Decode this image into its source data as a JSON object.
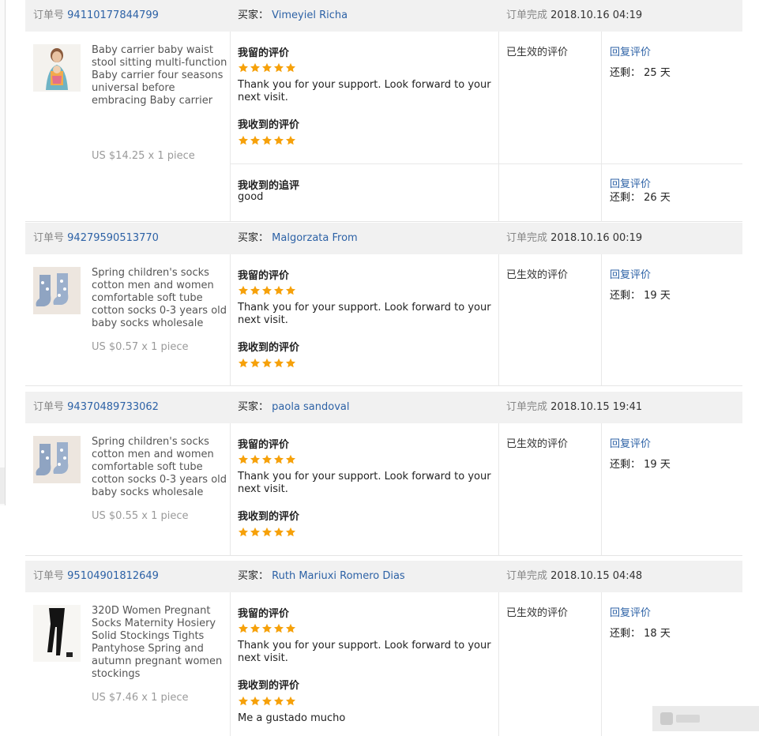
{
  "labels": {
    "order_no": "订单号",
    "buyer": "买家：",
    "order_done": "订单完成",
    "my_review": "我留的评价",
    "received_review": "我收到的评价",
    "received_followup": "我收到的追评",
    "status": "已生效的评价",
    "reply": "回复评价",
    "remaining": "还剩：",
    "days_unit": "天"
  },
  "colors": {
    "link": "#2d62a6",
    "star": "#f6a10a",
    "header_bg": "#f1f1f1"
  },
  "orders": [
    {
      "order_id": "94110177844799",
      "buyer": "Vimeyiel Richa",
      "completed": "2018.10.16 04:19",
      "product": {
        "image": "baby-carrier-photo",
        "title": "Baby carrier baby waist stool sitting multi-function Baby carrier four seasons universal before embracing Baby carrier",
        "price": "US $14.25 x 1 piece"
      },
      "my_review": {
        "stars": 5,
        "text": "Thank you for your support. Look forward to your next visit."
      },
      "received_review": {
        "stars": 5,
        "text": ""
      },
      "remaining_days": "25",
      "followup": {
        "text": "good",
        "remaining_days": "26"
      }
    },
    {
      "order_id": "94279590513770",
      "buyer": "Malgorzata From",
      "completed": "2018.10.16 00:19",
      "product": {
        "image": "baby-socks-photo",
        "title": "Spring children's socks cotton men and women comfortable soft tube cotton socks 0-3 years old baby socks wholesale",
        "price": "US $0.57 x 1 piece"
      },
      "my_review": {
        "stars": 5,
        "text": "Thank you for your support. Look forward to your next visit."
      },
      "received_review": {
        "stars": 5,
        "text": ""
      },
      "remaining_days": "19"
    },
    {
      "order_id": "94370489733062",
      "buyer": "paola sandoval",
      "completed": "2018.10.15 19:41",
      "product": {
        "image": "baby-socks-photo",
        "title": "Spring children's socks cotton men and women comfortable soft tube cotton socks 0-3 years old baby socks wholesale",
        "price": "US $0.55 x 1 piece"
      },
      "my_review": {
        "stars": 5,
        "text": "Thank you for your support. Look forward to your next visit."
      },
      "received_review": {
        "stars": 5,
        "text": ""
      },
      "remaining_days": "19"
    },
    {
      "order_id": "95104901812649",
      "buyer": "Ruth Mariuxi Romero Dias",
      "completed": "2018.10.15 04:48",
      "product": {
        "image": "pantyhose-photo",
        "title": "320D Women Pregnant Socks Maternity Hosiery Solid Stockings Tights Pantyhose Spring and autumn pregnant women stockings",
        "price": "US $7.46 x 1 piece"
      },
      "my_review": {
        "stars": 5,
        "text": "Thank you for your support. Look forward to your next visit."
      },
      "received_review": {
        "stars": 5,
        "text": "Me a gustado mucho"
      },
      "remaining_days": "18"
    }
  ]
}
